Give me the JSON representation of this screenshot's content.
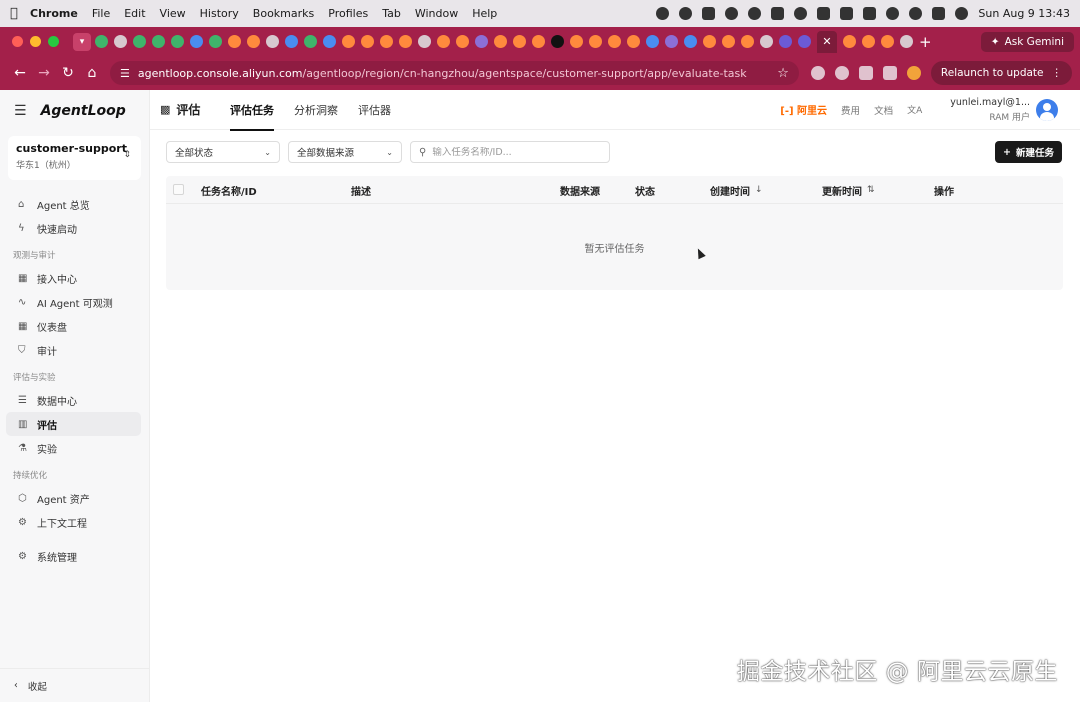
{
  "menubar": {
    "app_name": "Chrome",
    "items": [
      "File",
      "Edit",
      "View",
      "History",
      "Bookmarks",
      "Profiles",
      "Tab",
      "Window",
      "Help"
    ],
    "clock": "Sun Aug 9  13:43"
  },
  "browser": {
    "ask_gemini": "Ask Gemini",
    "url_host": "agentloop.console.aliyun.com",
    "url_path": "/agentloop/region/cn-hangzhou/agentspace/customer-support/app/evaluate-task",
    "relaunch": "Relaunch to update"
  },
  "sidebar": {
    "logo": "AgentLoop",
    "workspace_name": "customer-support",
    "workspace_region": "华东1（杭州）",
    "items_top": [
      {
        "label": "Agent 总览",
        "icon": "⌂"
      },
      {
        "label": "快速启动",
        "icon": "ϟ"
      }
    ],
    "group1": "观测与审计",
    "items_g1": [
      {
        "label": "接入中心",
        "icon": "▦"
      },
      {
        "label": "AI Agent 可观测",
        "icon": "∿"
      },
      {
        "label": "仪表盘",
        "icon": "▦"
      },
      {
        "label": "审计",
        "icon": "⛉"
      }
    ],
    "group2": "评估与实验",
    "items_g2": [
      {
        "label": "数据中心",
        "icon": "☰"
      },
      {
        "label": "评估",
        "icon": "▥"
      },
      {
        "label": "实验",
        "icon": "⚗"
      }
    ],
    "group3": "持续优化",
    "items_g3": [
      {
        "label": "Agent 资产",
        "icon": "⬡"
      },
      {
        "label": "上下文工程",
        "icon": "⚙"
      }
    ],
    "items_bottom": [
      {
        "label": "系统管理",
        "icon": "⚙"
      }
    ],
    "collapse_label": "收起"
  },
  "header": {
    "title": "评估",
    "tabs": [
      "评估任务",
      "分析洞察",
      "评估器"
    ],
    "brand": "阿里云",
    "cost": "费用",
    "docs": "文档",
    "user_name": "yunlei.mayl@1...",
    "user_role": "RAM 用户"
  },
  "filters": {
    "status": "全部状态",
    "source": "全部数据来源",
    "search_placeholder": "输入任务名称/ID..."
  },
  "actions": {
    "new_task": "新建任务"
  },
  "table": {
    "columns": [
      "任务名称/ID",
      "描述",
      "数据来源",
      "状态",
      "创建时间",
      "更新时间",
      "操作"
    ],
    "empty_text": "暂无评估任务"
  },
  "watermark": "掘金技术社区 @ 阿里云云原生",
  "colors": {
    "browser_accent": "#a3204a",
    "aliyun_orange": "#ff6a00",
    "primary_button": "#1a1a1a"
  }
}
